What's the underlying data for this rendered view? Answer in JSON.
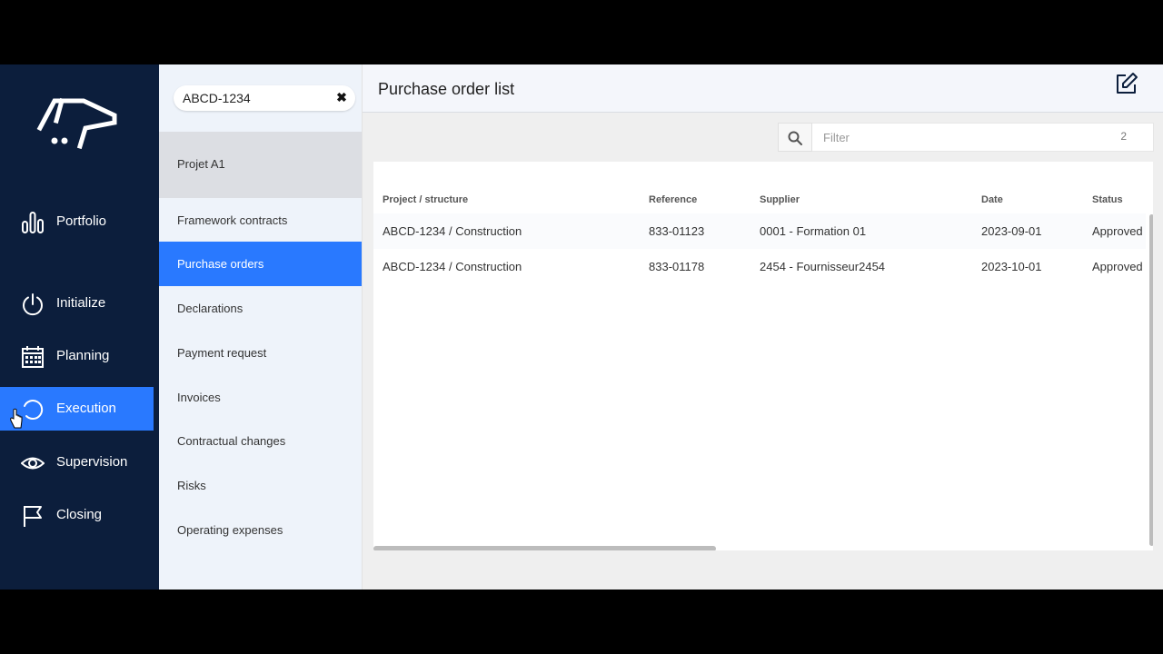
{
  "nav": {
    "items": [
      {
        "label": "Portfolio",
        "icon": "bar-chart-icon"
      },
      {
        "label": "Initialize",
        "icon": "power-icon"
      },
      {
        "label": "Planning",
        "icon": "calendar-icon"
      },
      {
        "label": "Execution",
        "icon": "circle-progress-icon"
      },
      {
        "label": "Supervision",
        "icon": "eye-icon"
      },
      {
        "label": "Closing",
        "icon": "flag-icon"
      }
    ],
    "active": "Execution",
    "active_color": "#2979ff",
    "background": "#0c1e3c"
  },
  "submenu": {
    "search_value": "ABCD-1234",
    "clear_icon": "close-icon",
    "project": "Projet A1",
    "items": [
      "Framework contracts",
      "Purchase orders",
      "Declarations",
      "Payment request",
      "Invoices",
      "Contractual changes",
      "Risks",
      "Operating expenses"
    ],
    "active": "Purchase orders"
  },
  "main": {
    "title": "Purchase order list",
    "edit_icon": "edit-icon",
    "filter": {
      "placeholder": "Filter",
      "count": "2",
      "icon": "search-icon"
    },
    "table": {
      "columns": [
        "Project / structure",
        "Reference",
        "Supplier",
        "Date",
        "Status"
      ],
      "rows": [
        [
          "ABCD-1234 / Construction",
          "833-01123",
          "0001 - Formation 01",
          "2023-09-01",
          "Approved"
        ],
        [
          "ABCD-1234 / Construction",
          "833-01178",
          "2454 - Fournisseur2454",
          "2023-10-01",
          "Approved"
        ]
      ]
    }
  }
}
